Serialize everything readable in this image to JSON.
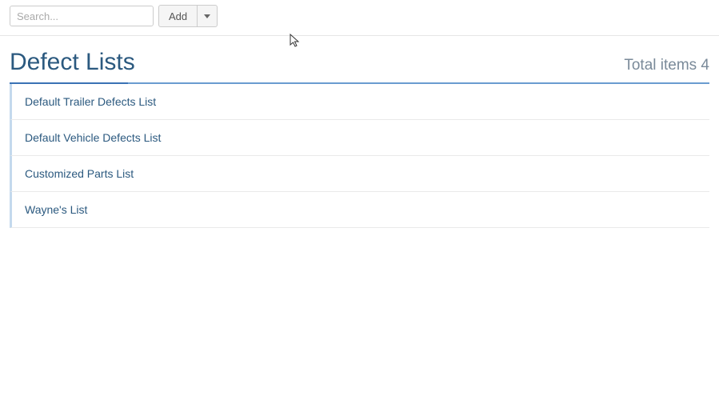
{
  "toolbar": {
    "search_placeholder": "Search...",
    "add_label": "Add"
  },
  "header": {
    "title": "Defect Lists",
    "total_label": "Total items 4"
  },
  "list": {
    "items": [
      {
        "name": "Default Trailer Defects List"
      },
      {
        "name": "Default Vehicle Defects List"
      },
      {
        "name": "Customized Parts List"
      },
      {
        "name": "Wayne's List"
      }
    ]
  }
}
